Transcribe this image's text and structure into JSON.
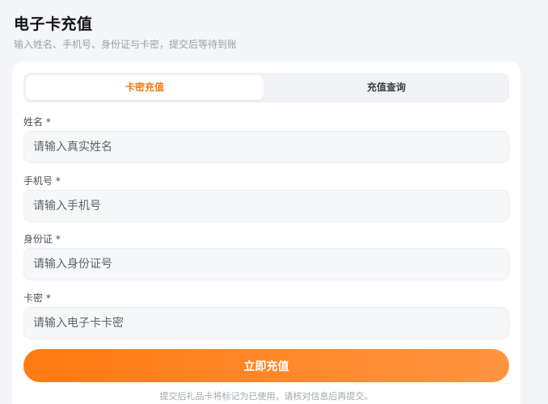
{
  "header": {
    "title": "电子卡充值",
    "subtitle": "输入姓名、手机号、身份证与卡密，提交后等待到账"
  },
  "tabs": [
    {
      "label": "卡密充值",
      "active": true
    },
    {
      "label": "充值查询",
      "active": false
    }
  ],
  "form": {
    "fields": [
      {
        "label": "姓名 *",
        "placeholder": "请输入真实姓名"
      },
      {
        "label": "手机号 *",
        "placeholder": "请输入手机号"
      },
      {
        "label": "身份证 *",
        "placeholder": "请输入身份证号"
      },
      {
        "label": "卡密 *",
        "placeholder": "请输入电子卡卡密"
      }
    ],
    "submit_label": "立即充值",
    "footnote": "提交后礼品卡将标记为已使用，请核对信息后再提交。"
  },
  "colors": {
    "accent": "#f07a12",
    "button_start": "#ff7a12",
    "button_end": "#ff9440"
  }
}
